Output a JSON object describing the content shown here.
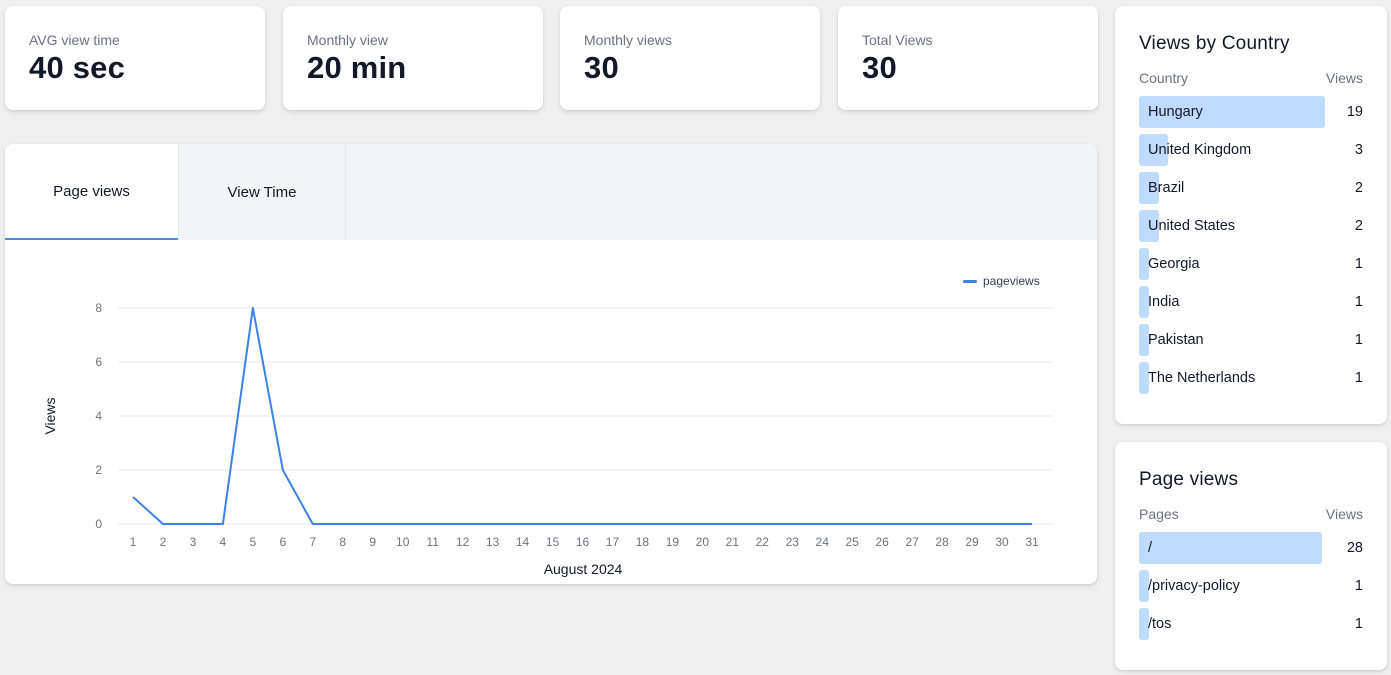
{
  "stats": [
    {
      "label": "AVG view time",
      "value": "40 sec"
    },
    {
      "label": "Monthly view",
      "value": "20 min"
    },
    {
      "label": "Monthly views",
      "value": "30"
    },
    {
      "label": "Total Views",
      "value": "30"
    }
  ],
  "tabs": {
    "page_views": "Page views",
    "view_time": "View Time",
    "active": "Page views"
  },
  "chart_data": {
    "type": "line",
    "xlabel": "August 2024",
    "ylabel": "Views",
    "x": [
      1,
      2,
      3,
      4,
      5,
      6,
      7,
      8,
      9,
      10,
      11,
      12,
      13,
      14,
      15,
      16,
      17,
      18,
      19,
      20,
      21,
      22,
      23,
      24,
      25,
      26,
      27,
      28,
      29,
      30,
      31
    ],
    "series": [
      {
        "name": "pageviews",
        "color": "#3b82e6",
        "values": [
          1,
          0,
          0,
          0,
          8,
          2,
          0,
          0,
          0,
          0,
          0,
          0,
          0,
          0,
          0,
          0,
          0,
          0,
          0,
          0,
          0,
          0,
          0,
          0,
          0,
          0,
          0,
          0,
          0,
          0,
          0
        ]
      }
    ],
    "ylim": [
      0,
      8
    ],
    "yticks": [
      0,
      2,
      4,
      6,
      8
    ],
    "grid": true,
    "legend": "top-right"
  },
  "country_panel": {
    "title": "Views by Country",
    "col_name": "Country",
    "col_value": "Views",
    "rows": [
      {
        "name": "Hungary",
        "views": 19
      },
      {
        "name": "United Kingdom",
        "views": 3
      },
      {
        "name": "Brazil",
        "views": 2
      },
      {
        "name": "United States",
        "views": 2
      },
      {
        "name": "Georgia",
        "views": 1
      },
      {
        "name": "India",
        "views": 1
      },
      {
        "name": "Pakistan",
        "views": 1
      },
      {
        "name": "The Netherlands",
        "views": 1
      }
    ]
  },
  "pages_panel": {
    "title": "Page views",
    "col_name": "Pages",
    "col_value": "Views",
    "rows": [
      {
        "name": "/",
        "views": 28
      },
      {
        "name": "/privacy-policy",
        "views": 1
      },
      {
        "name": "/tos",
        "views": 1
      }
    ]
  },
  "colors": {
    "accent": "#3b82e6",
    "bar_fill": "#bfdbfe"
  }
}
